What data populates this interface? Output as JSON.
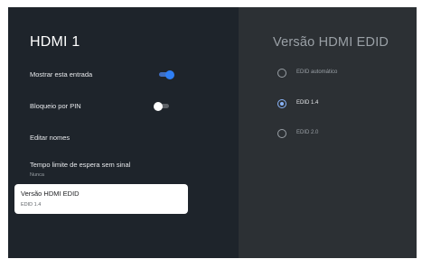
{
  "left_panel": {
    "title": "HDMI 1",
    "items": [
      {
        "label": "Mostrar esta entrada",
        "toggle": "on"
      },
      {
        "label": "Bloqueio por PIN",
        "toggle": "off"
      },
      {
        "label": "Editar nomes"
      },
      {
        "label": "Tempo limite de espera sem sinal",
        "sublabel": "Nunca"
      }
    ],
    "selected_item": {
      "label": "Versão HDMI EDID",
      "sublabel": "EDID 1.4"
    }
  },
  "right_panel": {
    "title": "Versão HDMI EDID",
    "options": [
      {
        "label": "EDID automático",
        "selected": false
      },
      {
        "label": "EDID 1.4",
        "selected": true
      },
      {
        "label": "EDID 2.0",
        "selected": false
      }
    ]
  },
  "colors": {
    "left_background": "#1e242b",
    "right_background": "#2c3034",
    "accent": "#2f7ff5",
    "radio_selected": "#8ab4f8"
  },
  "icons": {
    "toggle_on": "toggle-on-icon",
    "toggle_off": "toggle-off-icon",
    "radio_checked": "radio-checked-icon",
    "radio_unchecked": "radio-unchecked-icon"
  }
}
